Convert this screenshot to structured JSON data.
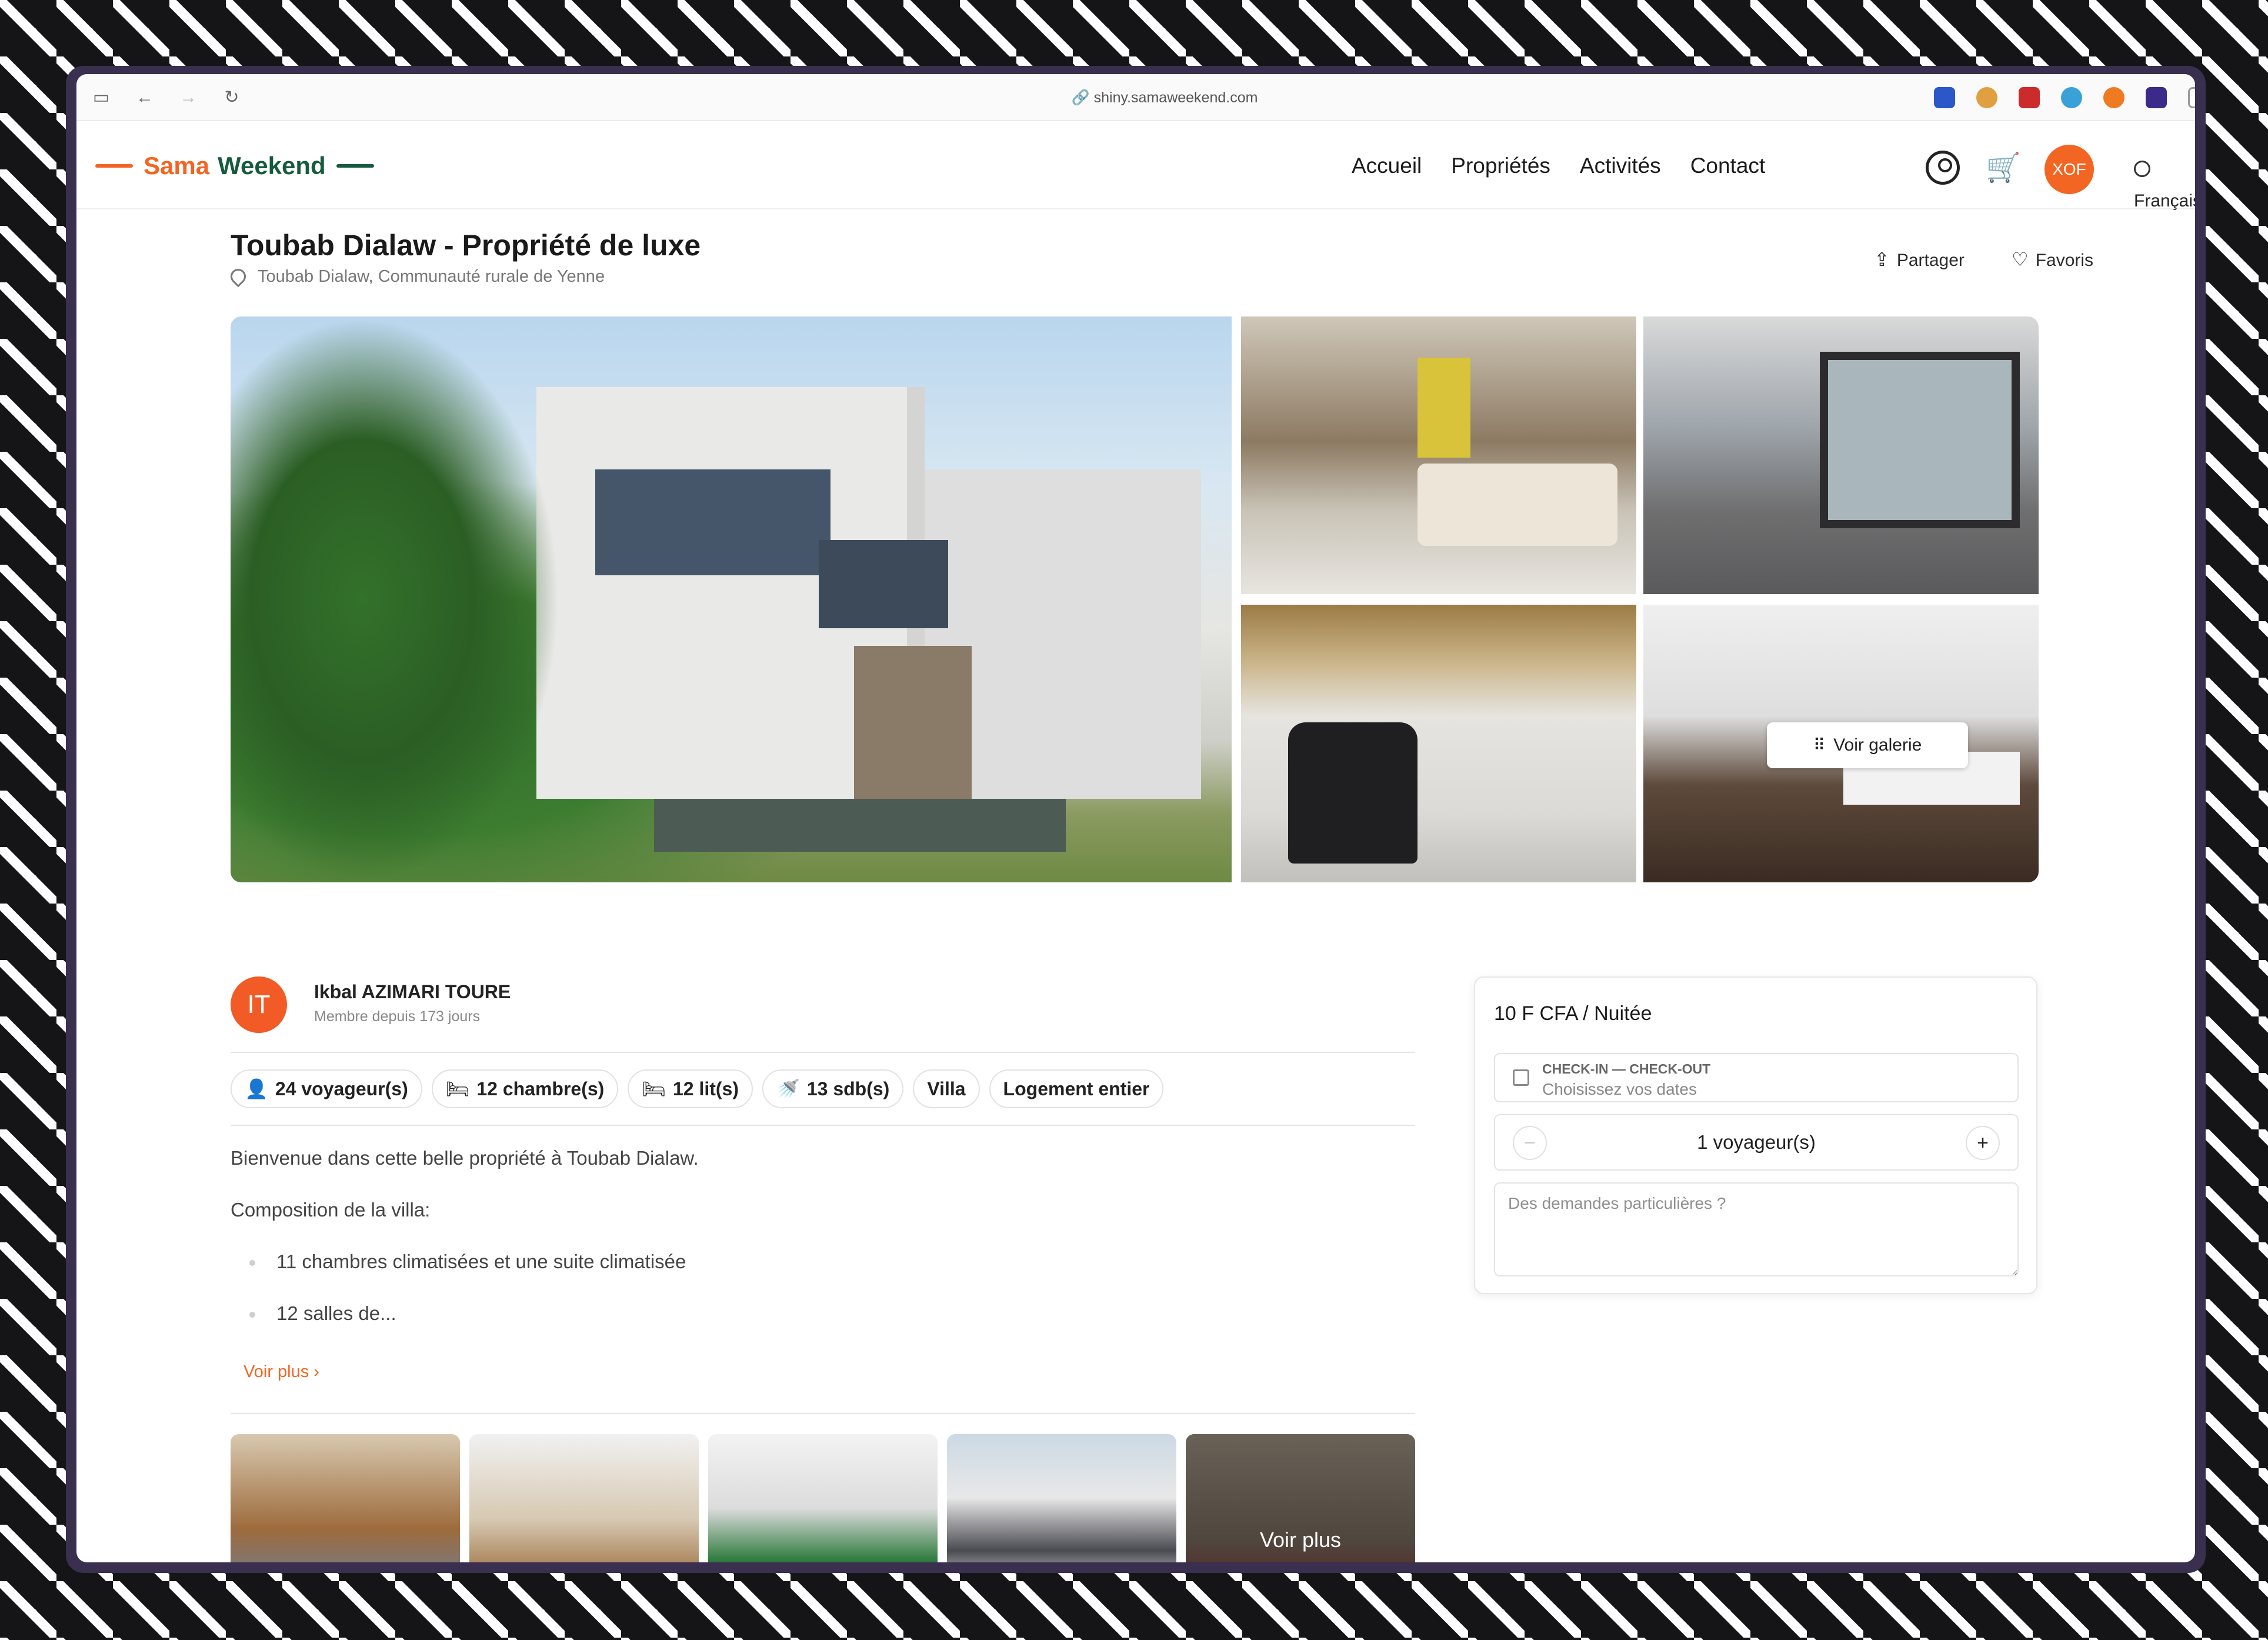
{
  "browser": {
    "url": "shiny.samaweekend.com"
  },
  "site": {
    "logo": {
      "part1": "Sama",
      "part2": "Weekend"
    },
    "nav": [
      "Accueil",
      "Propriétés",
      "Activités",
      "Contact"
    ],
    "currency": "XOF",
    "language": "Français"
  },
  "property": {
    "title": "Toubab Dialaw - Propriété de luxe",
    "location": "Toubab Dialaw, Communauté rurale de Yenne",
    "share_label": "Partager",
    "favorites_label": "Favoris",
    "gallery_button": "Voir galerie"
  },
  "host": {
    "initials": "IT",
    "name": "Ikbal AZIMARI TOURE",
    "since": "Membre depuis 173 jours"
  },
  "features": [
    {
      "icon": "person-icon",
      "label": "24 voyageur(s)"
    },
    {
      "icon": "bed-icon",
      "label": "12 chambre(s)"
    },
    {
      "icon": "bed-icon",
      "label": "12 lit(s)"
    },
    {
      "icon": "shower-icon",
      "label": "13 sdb(s)"
    },
    {
      "icon": "",
      "label": "Villa"
    },
    {
      "icon": "",
      "label": "Logement entier"
    }
  ],
  "description": {
    "intro": "Bienvenue dans cette belle propriété à Toubab Dialaw.",
    "composition": "Composition de la villa:",
    "items": [
      "11 chambres climatisées et une suite climatisée",
      "12 salles de..."
    ],
    "more_label": "Voir plus"
  },
  "thumbnails": {
    "overlay": "Voir plus"
  },
  "booking": {
    "price": "10 F CFA / Nuitée",
    "dates_label": "CHECK-IN — CHECK-OUT",
    "dates_placeholder": "Choisissez vos dates",
    "guests": "1 voyageur(s)",
    "requests_placeholder": "Des demandes particulières ?"
  },
  "colors": {
    "brand_orange": "#f26522",
    "brand_green": "#155b3d"
  }
}
